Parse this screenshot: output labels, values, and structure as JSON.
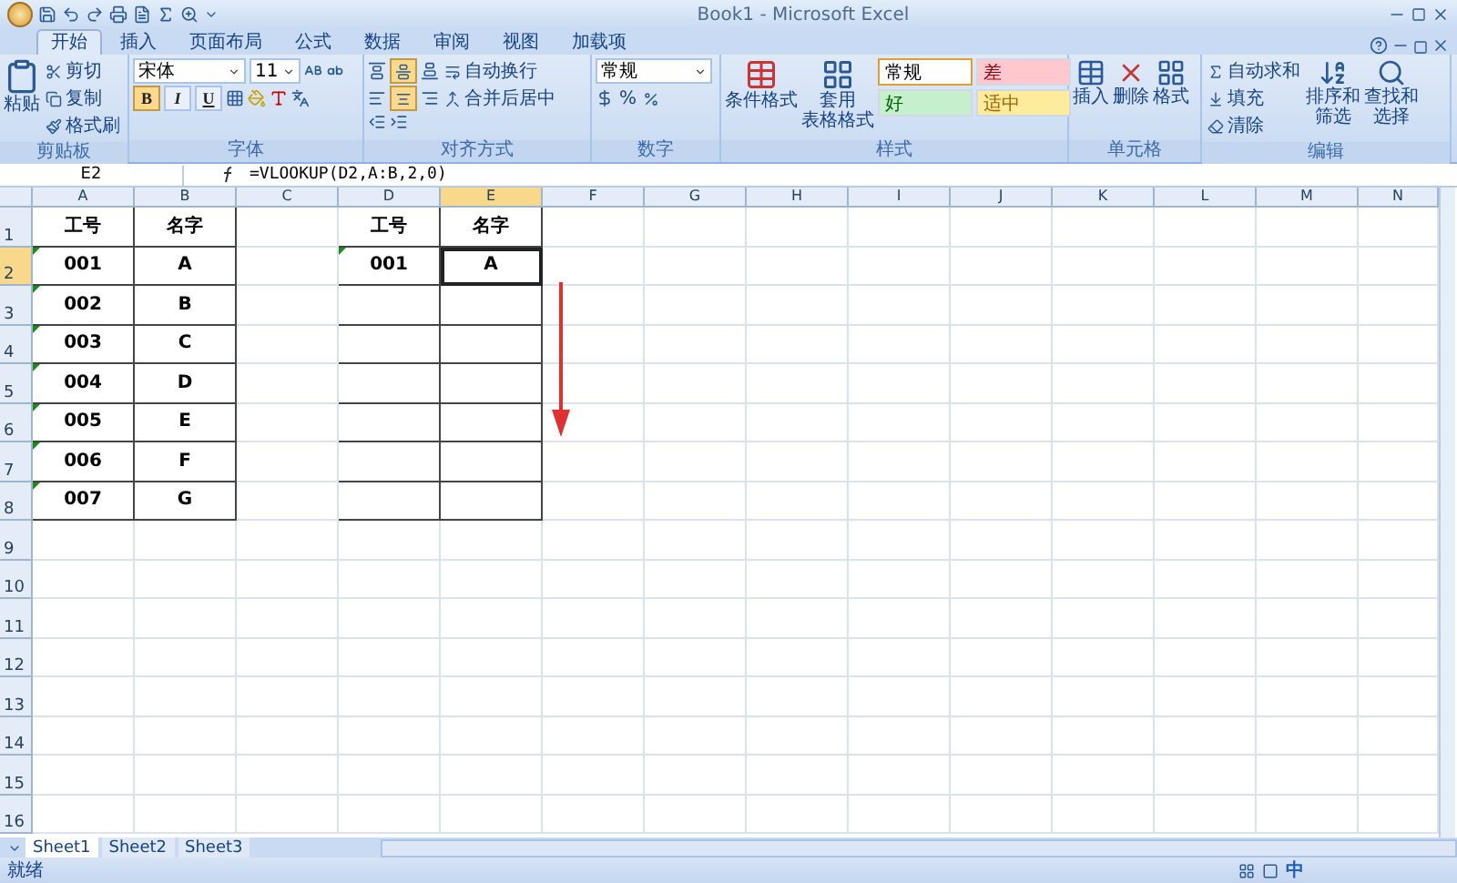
{
  "window": {
    "title": "Book1 - Microsoft Excel"
  },
  "tabs": [
    {
      "label": "开始",
      "selected": true
    },
    {
      "label": "插入",
      "selected": false
    },
    {
      "label": "页面布局",
      "selected": false
    },
    {
      "label": "公式",
      "selected": false
    },
    {
      "label": "数据",
      "selected": false
    },
    {
      "label": "审阅",
      "selected": false
    },
    {
      "label": "视图",
      "selected": false
    },
    {
      "label": "加载项",
      "selected": false
    }
  ],
  "ribbon": {
    "clipboard": {
      "label": "剪贴板",
      "paste": "粘贴",
      "cut": "剪切",
      "copy": "复制",
      "painter": "格式刷"
    },
    "font": {
      "label": "字体",
      "font_name": "宋体",
      "font_size": "11",
      "bold": "B",
      "italic": "I",
      "underline": "U",
      "bold_on": true
    },
    "alignment": {
      "label": "对齐方式",
      "wrap": "自动换行",
      "merge": "合并后居中",
      "middle_on": true,
      "center_on": true
    },
    "number": {
      "label": "数字",
      "format": "常规",
      "percent": "%"
    },
    "styles": {
      "label": "样式",
      "conditional": "条件格式",
      "table_1": "套用",
      "table_2": "表格格式",
      "swatches": [
        {
          "label": "常规",
          "kind": "normal",
          "color": "#ffffff",
          "selected": true
        },
        {
          "label": "差",
          "kind": "bad",
          "color": "#ffc7ce",
          "selected": false
        },
        {
          "label": "好",
          "kind": "good",
          "color": "#c6efce",
          "selected": false
        },
        {
          "label": "适中",
          "kind": "neutral",
          "color": "#ffeb9c",
          "selected": false
        }
      ]
    },
    "cells": {
      "label": "单元格",
      "insert": "插入",
      "delete": "删除",
      "format": "格式"
    },
    "editing": {
      "label": "编辑",
      "autosum": "自动求和",
      "fill": "填充",
      "clear": "清除",
      "sort_1": "排序和",
      "sort_2": "筛选",
      "find_1": "查找和",
      "find_2": "选择"
    }
  },
  "formula_bar": {
    "name_box": "E2",
    "formula": "=VLOOKUP(D2,A:B,2,0)"
  },
  "sheet": {
    "columns": [
      {
        "label": "A",
        "selected": false
      },
      {
        "label": "B",
        "selected": false
      },
      {
        "label": "C",
        "selected": false
      },
      {
        "label": "D",
        "selected": false
      },
      {
        "label": "E",
        "selected": true
      },
      {
        "label": "F",
        "selected": false
      },
      {
        "label": "G",
        "selected": false
      },
      {
        "label": "H",
        "selected": false
      },
      {
        "label": "I",
        "selected": false
      },
      {
        "label": "J",
        "selected": false
      },
      {
        "label": "K",
        "selected": false
      },
      {
        "label": "L",
        "selected": false
      },
      {
        "label": "M",
        "selected": false
      },
      {
        "label": "N",
        "selected": false
      }
    ],
    "rows": [
      {
        "number": "1",
        "selected": false,
        "cells": [
          {
            "text": "工号",
            "bordered": true,
            "flag": false,
            "selected": false
          },
          {
            "text": "名字",
            "bordered": true,
            "flag": false,
            "selected": false
          },
          "",
          {
            "text": "工号",
            "bordered": true,
            "flag": false,
            "selected": false
          },
          {
            "text": "名字",
            "bordered": true,
            "flag": false,
            "selected": false
          }
        ]
      },
      {
        "number": "2",
        "selected": true,
        "cells": [
          {
            "text": "001",
            "bordered": true,
            "flag": true,
            "selected": false
          },
          {
            "text": "A",
            "bordered": true,
            "flag": false,
            "selected": false
          },
          "",
          {
            "text": "001",
            "bordered": true,
            "flag": true,
            "selected": false
          },
          {
            "text": "A",
            "bordered": true,
            "flag": false,
            "selected": true
          }
        ]
      },
      {
        "number": "3",
        "selected": false,
        "cells": [
          {
            "text": "002",
            "bordered": true,
            "flag": true,
            "selected": false
          },
          {
            "text": "B",
            "bordered": true,
            "flag": false,
            "selected": false
          },
          "",
          {
            "text": "",
            "bordered": true,
            "flag": false,
            "selected": false
          },
          {
            "text": "",
            "bordered": true,
            "flag": false,
            "selected": false
          }
        ]
      },
      {
        "number": "4",
        "selected": false,
        "cells": [
          {
            "text": "003",
            "bordered": true,
            "flag": true,
            "selected": false
          },
          {
            "text": "C",
            "bordered": true,
            "flag": false,
            "selected": false
          },
          "",
          {
            "text": "",
            "bordered": true,
            "flag": false,
            "selected": false
          },
          {
            "text": "",
            "bordered": true,
            "flag": false,
            "selected": false
          }
        ]
      },
      {
        "number": "5",
        "selected": false,
        "cells": [
          {
            "text": "004",
            "bordered": true,
            "flag": true,
            "selected": false
          },
          {
            "text": "D",
            "bordered": true,
            "flag": false,
            "selected": false
          },
          "",
          {
            "text": "",
            "bordered": true,
            "flag": false,
            "selected": false
          },
          {
            "text": "",
            "bordered": true,
            "flag": false,
            "selected": false
          }
        ]
      },
      {
        "number": "6",
        "selected": false,
        "cells": [
          {
            "text": "005",
            "bordered": true,
            "flag": true,
            "selected": false
          },
          {
            "text": "E",
            "bordered": true,
            "flag": false,
            "selected": false
          },
          "",
          {
            "text": "",
            "bordered": true,
            "flag": false,
            "selected": false
          },
          {
            "text": "",
            "bordered": true,
            "flag": false,
            "selected": false
          }
        ]
      },
      {
        "number": "7",
        "selected": false,
        "cells": [
          {
            "text": "006",
            "bordered": true,
            "flag": true,
            "selected": false
          },
          {
            "text": "F",
            "bordered": true,
            "flag": false,
            "selected": false
          },
          "",
          {
            "text": "",
            "bordered": true,
            "flag": false,
            "selected": false
          },
          {
            "text": "",
            "bordered": true,
            "flag": false,
            "selected": false
          }
        ]
      },
      {
        "number": "8",
        "selected": false,
        "cells": [
          {
            "text": "007",
            "bordered": true,
            "flag": true,
            "selected": false
          },
          {
            "text": "G",
            "bordered": true,
            "flag": false,
            "selected": false
          },
          "",
          {
            "text": "",
            "bordered": true,
            "flag": false,
            "selected": false
          },
          {
            "text": "",
            "bordered": true,
            "flag": false,
            "selected": false
          }
        ]
      },
      {
        "number": "9",
        "selected": false,
        "cells": []
      },
      {
        "number": "10",
        "selected": false,
        "cells": []
      },
      {
        "number": "11",
        "selected": false,
        "cells": []
      },
      {
        "number": "12",
        "selected": false,
        "cells": []
      },
      {
        "number": "13",
        "selected": false,
        "cells": []
      },
      {
        "number": "14",
        "selected": false,
        "cells": []
      },
      {
        "number": "15",
        "selected": false,
        "cells": []
      },
      {
        "number": "16",
        "selected": false,
        "cells": []
      }
    ]
  },
  "sheet_tabs": [
    {
      "label": "Sheet1",
      "selected": true
    },
    {
      "label": "Sheet2",
      "selected": false
    },
    {
      "label": "Sheet3",
      "selected": false
    }
  ],
  "status_bar": {
    "status": "就绪",
    "ime": "中"
  }
}
